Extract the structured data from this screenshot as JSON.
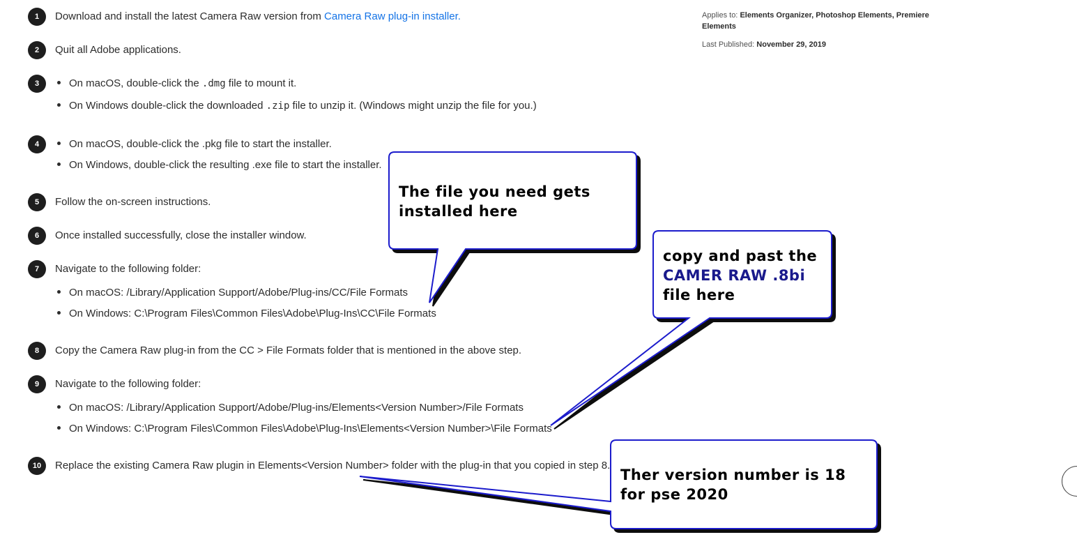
{
  "steps": [
    {
      "num": "1",
      "text": "Download and install the latest Camera Raw version from ",
      "link": "Camera Raw plug-in installer."
    },
    {
      "num": "2",
      "text": "Quit all Adobe applications."
    },
    {
      "num": "3",
      "bullets": [
        {
          "pre": "On macOS, double-click the ",
          "code": ".dmg",
          "post": " file to mount it."
        },
        {
          "pre": "On Windows double-click the downloaded ",
          "code": ".zip",
          "post": " file to unzip it. (Windows might unzip the file for you.)"
        }
      ]
    },
    {
      "num": "4",
      "bullets": [
        {
          "text": "On macOS, double-click the .pkg file to start the installer."
        },
        {
          "text": "On Windows, double-click the resulting .exe file to start the installer."
        }
      ]
    },
    {
      "num": "5",
      "text": "Follow the on-screen instructions."
    },
    {
      "num": "6",
      "text": "Once installed successfully, close the installer window."
    },
    {
      "num": "7",
      "text": "Navigate to the following folder:",
      "bullets": [
        {
          "text": "On macOS: /Library/Application Support/Adobe/Plug-ins/CC/File Formats"
        },
        {
          "text": "On Windows: C:\\Program Files\\Common Files\\Adobe\\Plug-Ins\\CC\\File Formats"
        }
      ]
    },
    {
      "num": "8",
      "text": "Copy the Camera Raw plug-in from the CC > File Formats folder that is mentioned in the above step."
    },
    {
      "num": "9",
      "text": "Navigate to the following folder:",
      "bullets": [
        {
          "text": "On macOS: /Library/Application Support/Adobe/Plug-ins/Elements<Version Number>/File Formats"
        },
        {
          "text": "On Windows: C:\\Program Files\\Common Files\\Adobe\\Plug-Ins\\Elements<Version Number>\\File Formats"
        }
      ]
    },
    {
      "num": "10",
      "text": "Replace the existing Camera Raw plugin in Elements<Version Number> folder with the plug-in that you copied in step 8."
    }
  ],
  "meta": {
    "applies_label": "Applies to:",
    "applies_1": "Elements Organizer,",
    "applies_2": "Photoshop Elements,",
    "applies_3": "Premiere",
    "applies_4": "Elements",
    "published_label": "Last Published:",
    "published_date": "November 29, 2019"
  },
  "callouts": {
    "c1_line1": "The file you need gets",
    "c1_line2": "installed here",
    "c2_line1": "copy and past the",
    "c2_line2": "CAMER RAW .8bi",
    "c2_line3": "file here",
    "c3_line1": "Ther version number is 18",
    "c3_line2": "for pse 2020"
  },
  "colors": {
    "link": "#1473e6",
    "callout_border": "#1a1acc",
    "callout_text_blue": "#1a1a8c",
    "badge": "#1e1e1e"
  }
}
